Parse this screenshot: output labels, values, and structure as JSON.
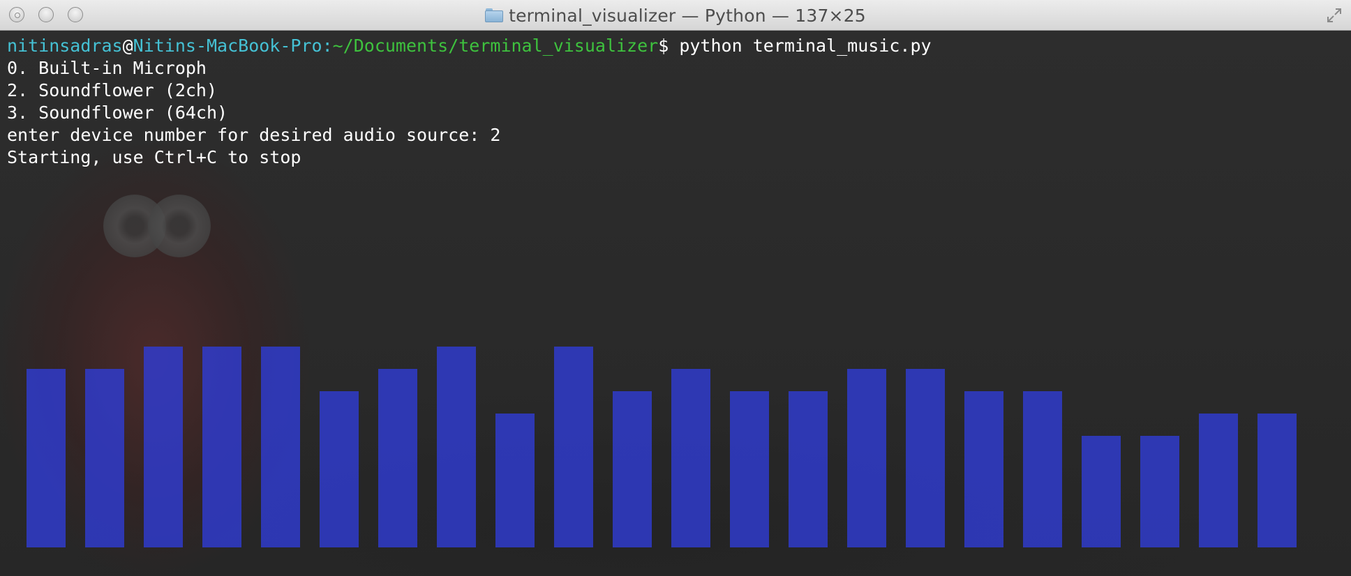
{
  "window": {
    "title": "terminal_visualizer — Python — 137×25"
  },
  "terminal": {
    "prompt": {
      "user": "nitinsadras",
      "at": "@",
      "host": "Nitins-MacBook-Pro:",
      "path": "~/Documents/terminal_visualizer",
      "symbol": "$",
      "command": " python terminal_music.py"
    },
    "lines": [
      "0. Built-in Microph",
      "2. Soundflower (2ch)",
      "3. Soundflower (64ch)",
      "enter device number for desired audio source: 2",
      "Starting, use Ctrl+C to stop"
    ]
  },
  "visualizer": {
    "bar_levels": [
      8,
      8,
      9,
      9,
      9,
      7,
      8,
      9,
      6,
      9,
      7,
      8,
      7,
      7,
      8,
      8,
      7,
      7,
      5,
      5,
      6,
      6
    ],
    "max_level": 9,
    "bar_color": "#303cd2"
  },
  "colors": {
    "prompt_user": "#45c1d4",
    "prompt_path": "#3ec23e",
    "text": "#ffffff",
    "background": "#2a2a2a"
  }
}
